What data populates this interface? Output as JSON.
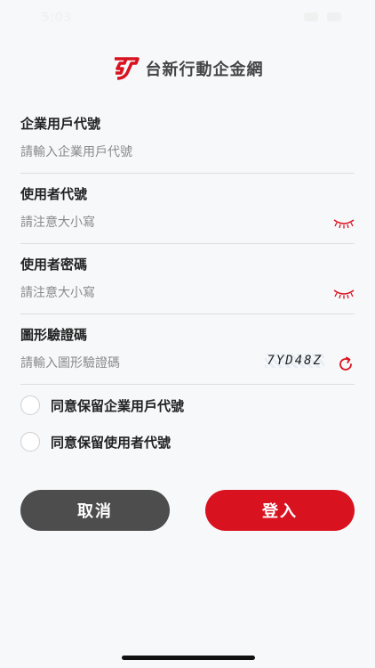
{
  "status_bar": {
    "time": "5:03"
  },
  "brand": {
    "name": "台新行動企金網",
    "logo_color": "#d9121f"
  },
  "form": {
    "company_id": {
      "label": "企業用戶代號",
      "placeholder": "請輸入企業用戶代號",
      "value": ""
    },
    "user_id": {
      "label": "使用者代號",
      "placeholder": "請注意大小寫",
      "value": ""
    },
    "password": {
      "label": "使用者密碼",
      "placeholder": "請注意大小寫",
      "value": ""
    },
    "captcha": {
      "label": "圖形驗證碼",
      "placeholder": "請輸入圖形驗證碼",
      "value": "",
      "image_text": "7YD48Z"
    }
  },
  "options": {
    "remember_company": {
      "label": "同意保留企業用戶代號",
      "checked": false
    },
    "remember_user": {
      "label": "同意保留使用者代號",
      "checked": false
    }
  },
  "actions": {
    "cancel_label": "取消",
    "login_label": "登入"
  },
  "colors": {
    "accent": "#d9121f",
    "cancel": "#4d4d4d",
    "background": "#f7f8fa"
  },
  "icons": {
    "password_toggle": "eye-closed-icon",
    "captcha_refresh": "refresh-icon"
  }
}
